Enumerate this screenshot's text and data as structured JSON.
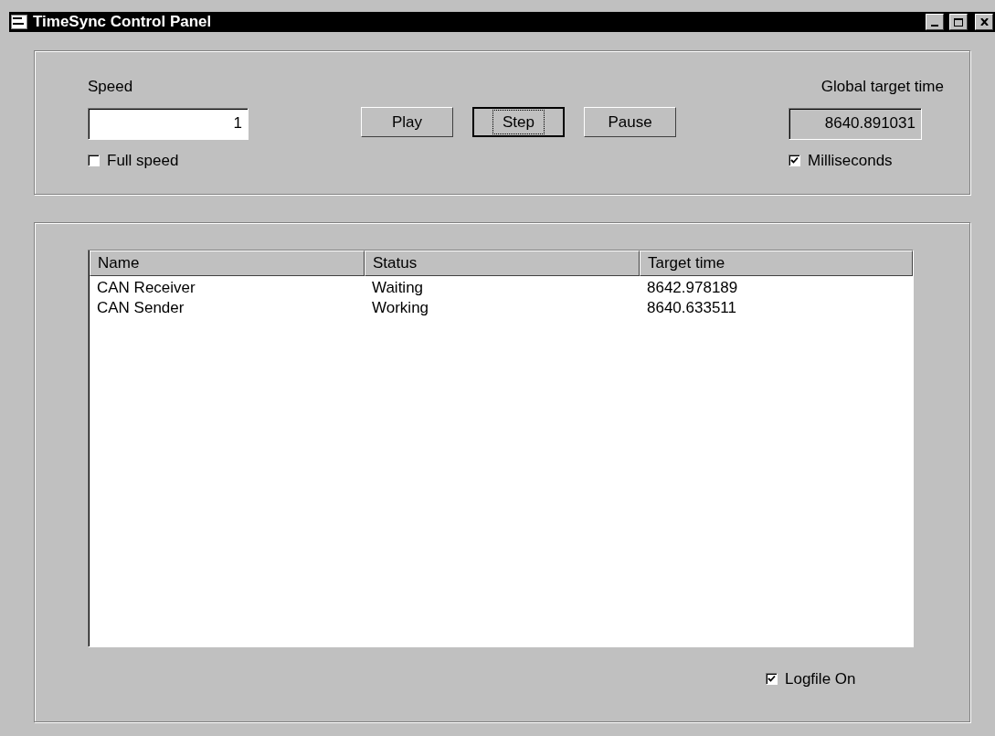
{
  "window": {
    "title": "TimeSync Control Panel"
  },
  "speed": {
    "label": "Speed",
    "value": "1",
    "full_speed": {
      "label": "Full speed",
      "checked": false
    }
  },
  "buttons": [
    {
      "label": "Play",
      "focused": false
    },
    {
      "label": "Step",
      "focused": true
    },
    {
      "label": "Pause",
      "focused": false
    }
  ],
  "global_target": {
    "label": "Global target time",
    "value": "8640.891031",
    "milliseconds": {
      "label": "Milliseconds",
      "checked": true
    }
  },
  "table": {
    "columns": [
      "Name",
      "Status",
      "Target time"
    ],
    "rows": [
      [
        "CAN Receiver",
        "Waiting",
        "8642.978189"
      ],
      [
        "CAN Sender",
        "Working",
        "8640.633511"
      ]
    ]
  },
  "logfile": {
    "label": "Logfile On",
    "checked": true
  }
}
